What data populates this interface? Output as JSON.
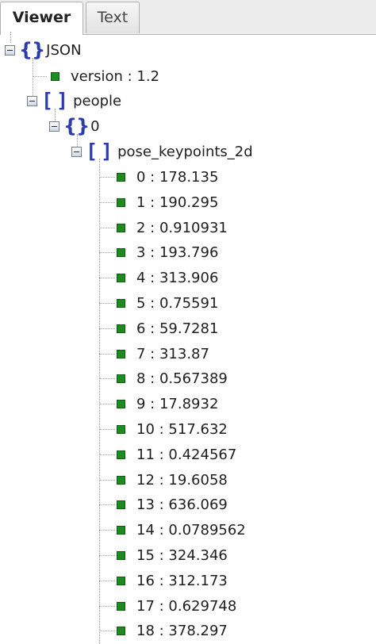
{
  "tabs": [
    {
      "label": "Viewer",
      "active": true
    },
    {
      "label": "Text",
      "active": false
    }
  ],
  "tree": {
    "root_label": "JSON",
    "version_entry": "version : 1.2",
    "people_label": "people",
    "person_index_label": "0",
    "keypoints_label": "pose_keypoints_2d",
    "keypoints": [
      "0 : 178.135",
      "1 : 190.295",
      "2 : 0.910931",
      "3 : 193.796",
      "4 : 313.906",
      "5 : 0.75591",
      "6 : 59.7281",
      "7 : 313.87",
      "8 : 0.567389",
      "9 : 17.8932",
      "10 : 517.632",
      "11 : 0.424567",
      "12 : 19.6058",
      "13 : 636.069",
      "14 : 0.0789562",
      "15 : 324.346",
      "16 : 312.173",
      "17 : 0.629748",
      "18 : 378.297"
    ]
  },
  "colors": {
    "bracket": "#2b3bb0",
    "leaf": "#1f8a1f"
  }
}
